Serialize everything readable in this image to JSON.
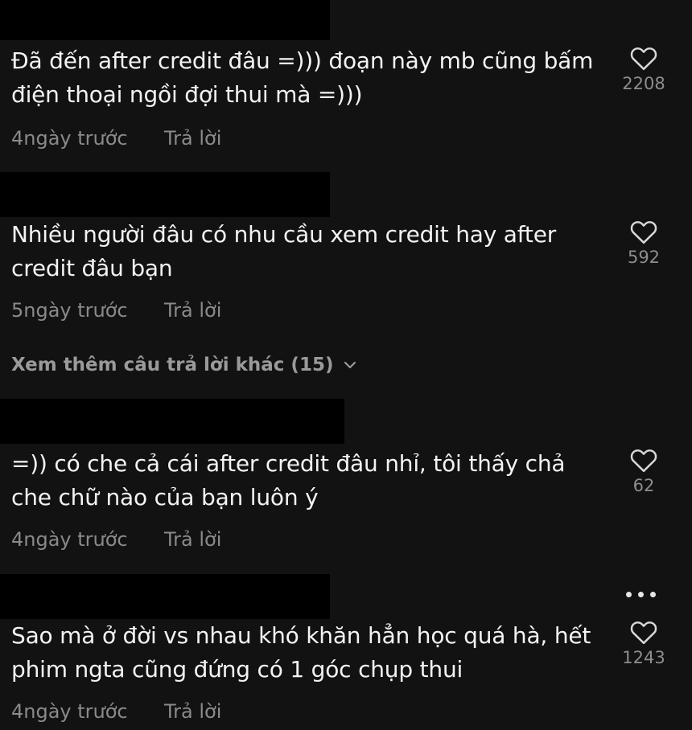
{
  "comments": [
    {
      "text": "Đã đến after credit đâu =))) đoạn này mb cũng bấm điện thoại ngồi đợi thui mà =)))",
      "time": "4ngày trước",
      "reply_label": "Trả lời",
      "likes": "2208",
      "like_icon": "heart-outline-icon"
    },
    {
      "text": "Nhiều người đâu có nhu cầu xem credit hay after credit đâu bạn",
      "time": "5ngày trước",
      "reply_label": "Trả lời",
      "likes": "592",
      "like_icon": "heart-outline-icon"
    },
    {
      "text": "=)) có che cả cái after credit đâu nhỉ, tôi thấy chả che chữ nào của bạn luôn ý",
      "time": "4ngày trước",
      "reply_label": "Trả lời",
      "likes": "62",
      "like_icon": "heart-outline-icon"
    },
    {
      "text": "Sao mà ở đời vs nhau khó khăn hẳn học quá hà, hết phim ngta cũng đứng có 1 góc chụp thui",
      "time": "4ngày trước",
      "reply_label": "Trả lời",
      "likes": "1243",
      "like_icon": "heart-outline-icon"
    }
  ],
  "view_more_replies": "Xem thêm câu trả lời khác (15)",
  "icons": {
    "expand": "chevron-down-icon",
    "more": "more-options-icon"
  },
  "colors": {
    "background": "#121212",
    "text": "#f3f3f3",
    "secondary": "#8a8a8a",
    "redaction": "#000000"
  }
}
